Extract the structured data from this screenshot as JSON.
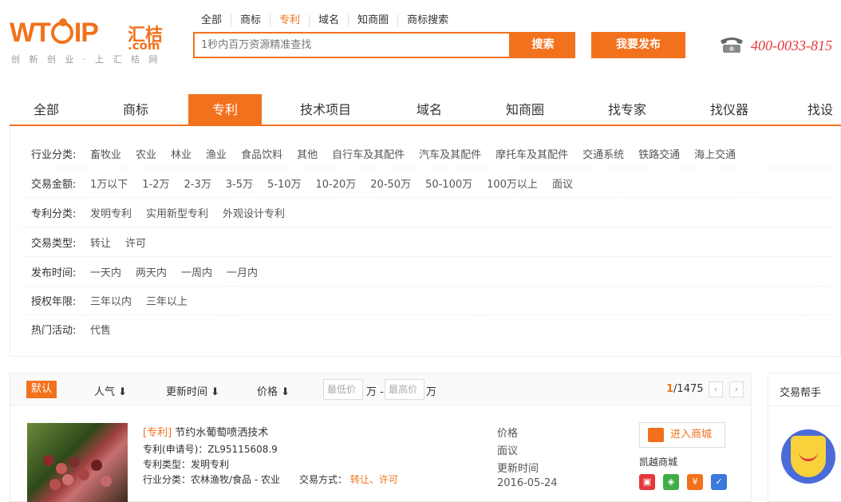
{
  "header": {
    "logo_main": "WTOIP",
    "logo_cn": "汇桔",
    "logo_com": ".com",
    "slogan": "创 新 创 业 · 上 汇 桔 网",
    "search_tabs": [
      "全部",
      "商标",
      "专利",
      "域名",
      "知商圈",
      "商标搜索"
    ],
    "active_search_tab": "专利",
    "search_placeholder": "1秒内百万资源精准查找",
    "search_button": "搜索",
    "publish_button": "我要发布",
    "phone": "400-0033-815"
  },
  "main_nav": {
    "items": [
      "全部",
      "商标",
      "专利",
      "技术项目",
      "域名",
      "知商圈",
      "找专家",
      "找仪器",
      "找设"
    ],
    "active": "专利"
  },
  "filters": [
    {
      "label": "行业分类:",
      "options": [
        "畜牧业",
        "农业",
        "林业",
        "渔业",
        "食品饮料",
        "其他",
        "自行车及其配件",
        "汽车及其配件",
        "摩托车及其配件",
        "交通系统",
        "铁路交通",
        "海上交通"
      ]
    },
    {
      "label": "交易金额:",
      "options": [
        "1万以下",
        "1-2万",
        "2-3万",
        "3-5万",
        "5-10万",
        "10-20万",
        "20-50万",
        "50-100万",
        "100万以上",
        "面议"
      ]
    },
    {
      "label": "专利分类:",
      "options": [
        "发明专利",
        "实用新型专利",
        "外观设计专利"
      ]
    },
    {
      "label": "交易类型:",
      "options": [
        "转让",
        "许可"
      ]
    },
    {
      "label": "发布时间:",
      "options": [
        "一天内",
        "两天内",
        "一周内",
        "一月内"
      ]
    },
    {
      "label": "授权年限:",
      "options": [
        "三年以内",
        "三年以上"
      ]
    },
    {
      "label": "热门活动:",
      "options": [
        "代售"
      ]
    }
  ],
  "sort_bar": {
    "default": "默认",
    "popularity": "人气",
    "update_time": "更新时间",
    "price": "价格",
    "min_price_placeholder": "最低价",
    "max_price_placeholder": "最高价",
    "unit": "万",
    "dash": "-",
    "current_page": "1",
    "total_pages": "/1475",
    "prev": "‹",
    "next": "›"
  },
  "item": {
    "tag": "[专利]",
    "title": "节约水葡萄喷洒技术",
    "app_no_label": "专利(申请号)：",
    "app_no": "ZL95115608.9",
    "type_label": "专利类型：",
    "type": "发明专利",
    "industry_label": "行业分类：",
    "industry": "农林渔牧/食品 - 农业",
    "trade_label": "交易方式：",
    "trade": "转让、许可",
    "price_label": "价格",
    "price": "面议",
    "update_label": "更新时间",
    "update_date": "2016-05-24",
    "shop_button": "进入商城",
    "shop_name": "凯越商城"
  },
  "helper": {
    "title": "交易帮手"
  },
  "colors": {
    "accent": "#f2711c",
    "phone": "#e4393c"
  }
}
